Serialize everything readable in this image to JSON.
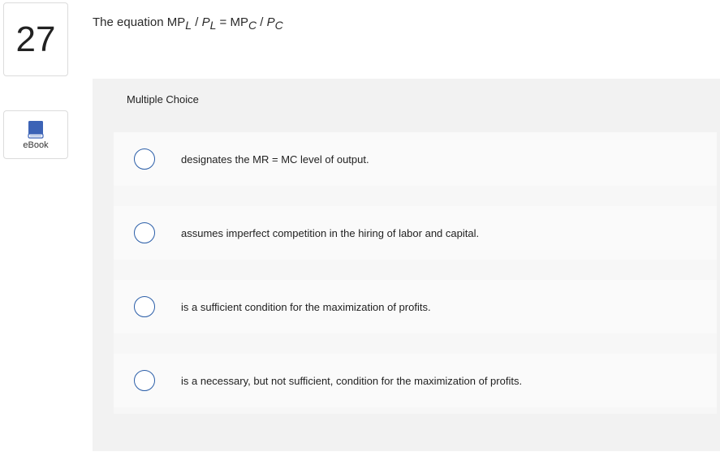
{
  "question": {
    "number": "27",
    "ebook_label": "eBook",
    "prompt": {
      "lead": "The equation MP",
      "sub1": "L",
      "slash1": " / ",
      "p1": "P",
      "sub2": "L",
      "equals": " = MP",
      "sub3": "C",
      "slash2": " / ",
      "p2": "P",
      "sub4": "C"
    }
  },
  "panel": {
    "header": "Multiple Choice",
    "choices": [
      {
        "text": "designates the MR = MC level of output."
      },
      {
        "text": "assumes imperfect competition in the hiring of labor and capital."
      },
      {
        "text": "is a sufficient condition for the maximization of profits."
      },
      {
        "text": "is a necessary, but not sufficient, condition for the maximization of profits."
      }
    ]
  },
  "colors": {
    "radio_border": "#2b5ea8",
    "ebook_icon": "#3c63b6",
    "panel_bg": "#f2f2f2"
  }
}
